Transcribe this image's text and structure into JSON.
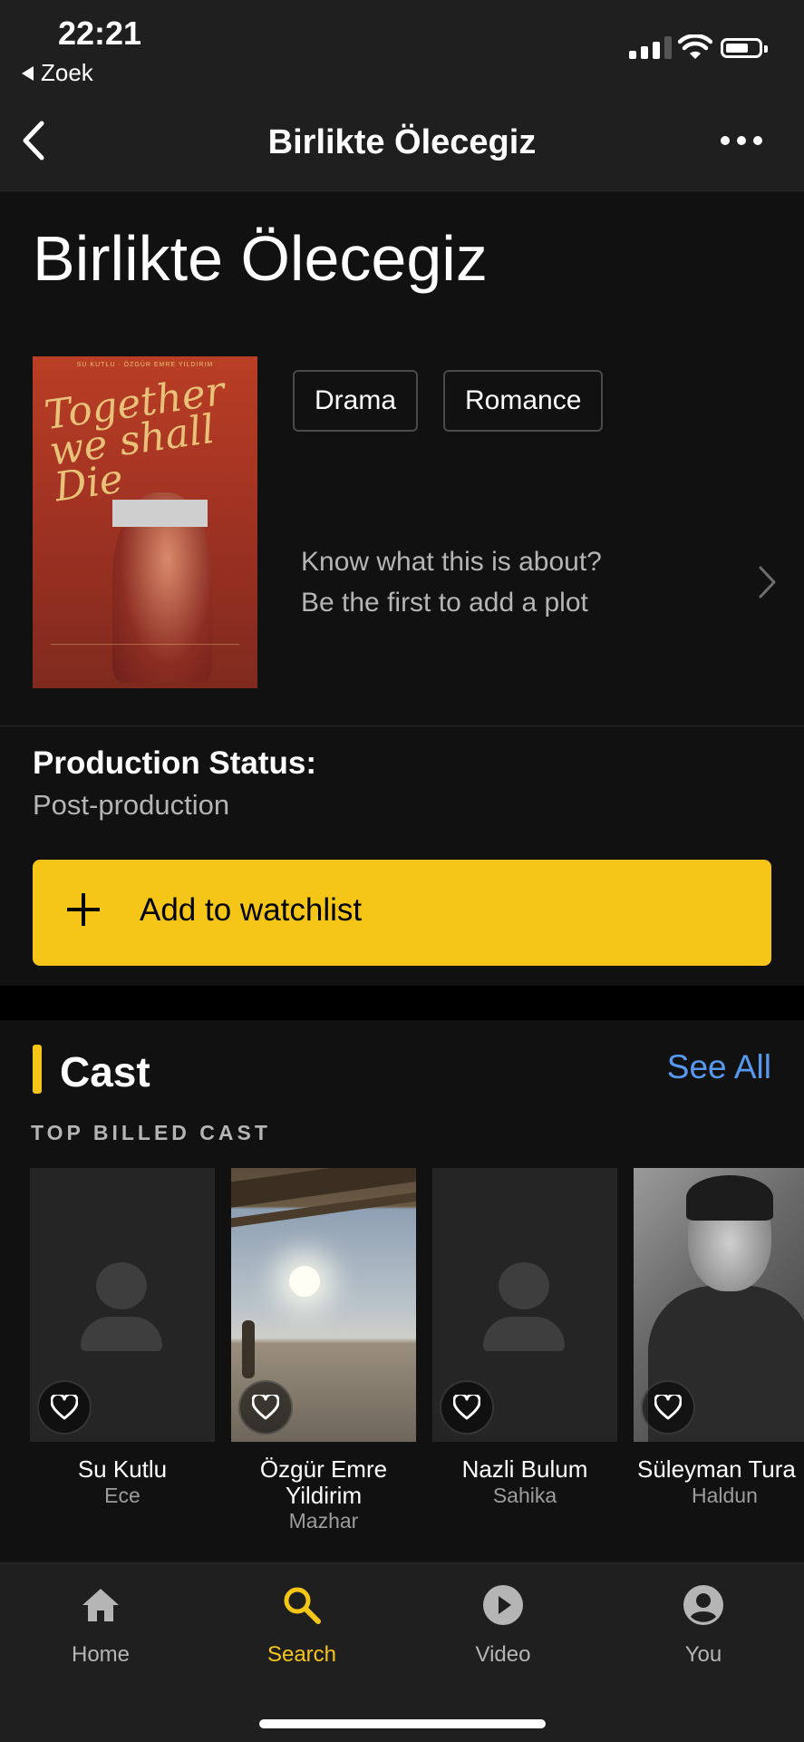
{
  "status_bar": {
    "time": "22:21",
    "back_app": "Zoek"
  },
  "nav": {
    "title": "Birlikte Ölecegiz"
  },
  "movie": {
    "title": "Birlikte Ölecegiz",
    "poster_text": "Together we shall Die",
    "genres": [
      "Drama",
      "Romance"
    ],
    "plot_prompt_line1": "Know what this is about?",
    "plot_prompt_line2": "Be the first to add a plot",
    "production_status_label": "Production Status:",
    "production_status_value": "Post-production"
  },
  "watchlist": {
    "label": "Add to watchlist"
  },
  "cast_section": {
    "title": "Cast",
    "see_all": "See All",
    "subheading": "TOP BILLED CAST",
    "members": [
      {
        "name": "Su Kutlu",
        "role": "Ece",
        "photo": "placeholder"
      },
      {
        "name_line1": "Özgür Emre",
        "name_line2": "Yildirim",
        "role": "Mazhar",
        "photo": "photo"
      },
      {
        "name": "Nazli Bulum",
        "role": "Sahika",
        "photo": "placeholder"
      },
      {
        "name": "Süleyman Tura",
        "role": "Haldun",
        "photo": "photo"
      }
    ]
  },
  "tabs": [
    {
      "label": "Home",
      "icon": "home-icon",
      "active": false
    },
    {
      "label": "Search",
      "icon": "search-icon",
      "active": true
    },
    {
      "label": "Video",
      "icon": "play-icon",
      "active": false
    },
    {
      "label": "You",
      "icon": "account-icon",
      "active": false
    }
  ],
  "colors": {
    "accent": "#f5c518",
    "link": "#5799ef",
    "background": "#111111",
    "bar": "#1f1f1f"
  }
}
